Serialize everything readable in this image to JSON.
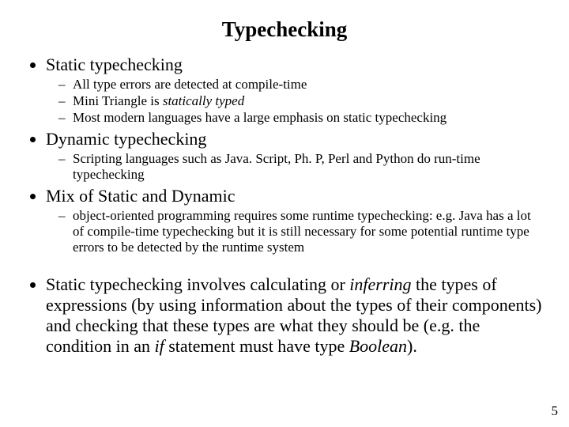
{
  "title": "Typechecking",
  "b1": {
    "label": "Static typechecking"
  },
  "s1a": "All type errors are detected at compile-time",
  "s1b_pre": "Mini Triangle is ",
  "s1b_em": "statically typed",
  "s1c": "Most modern languages have a large emphasis on static typechecking",
  "b2": {
    "label": "Dynamic typechecking"
  },
  "s2a": "Scripting languages such as Java. Script, Ph. P, Perl and Python do run-time typechecking",
  "b3": {
    "label": "Mix of Static and Dynamic"
  },
  "s3a": "object-oriented programming requires some runtime typechecking: e.g. Java has a lot of compile-time typechecking but it is still necessary for some potential runtime type errors to be detected by the runtime system",
  "b4": {
    "t1": "Static typechecking involves calculating or ",
    "em1": "inferring",
    "t2": " the types of expressions (by using information about the types of their components) and checking that these types are what they should be (e.g. the condition in an ",
    "em2": "if",
    "t3": " statement must have type ",
    "em3": "Boolean",
    "t4": ")."
  },
  "pagenum": "5"
}
